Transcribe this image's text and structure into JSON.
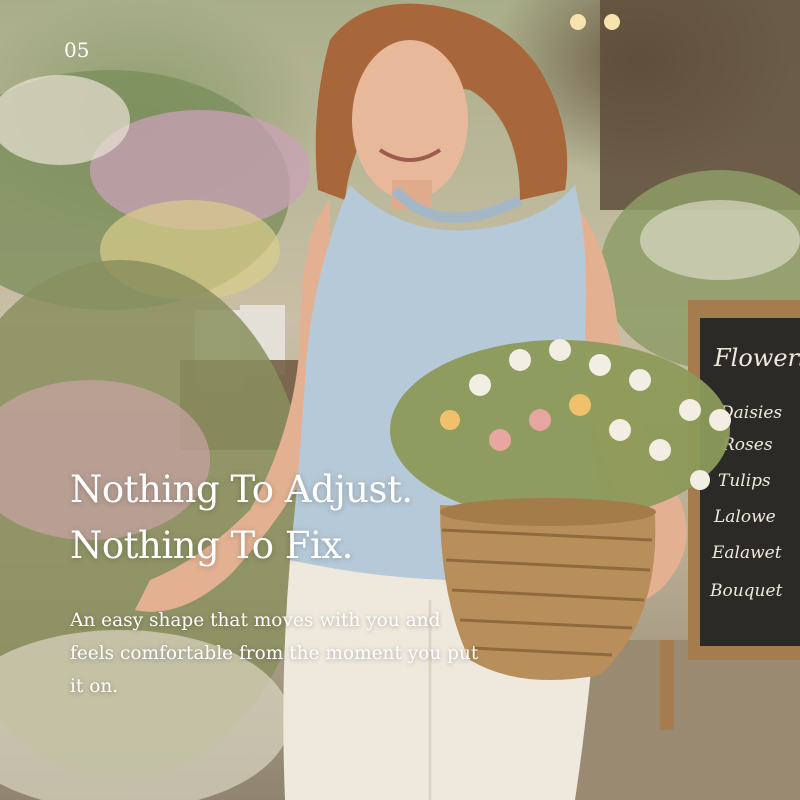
{
  "page_number": "05",
  "headline": {
    "line1": "Nothing To Adjust.",
    "line2": "Nothing To Fix."
  },
  "body_text": "An easy shape that moves with you and feels comfortable from the moment you put it on.",
  "chalkboard_sign": {
    "title": "Flowers",
    "items": [
      "Daisies",
      "Roses",
      "Tulips",
      "Lalowe",
      "Ealawet",
      "Bouquet"
    ]
  },
  "colors": {
    "text": "#ffffff",
    "top": "#b6c9d8",
    "pants": "#efe8dc",
    "basket": "#b88f5a",
    "chalkboard": "#2b2a27"
  }
}
